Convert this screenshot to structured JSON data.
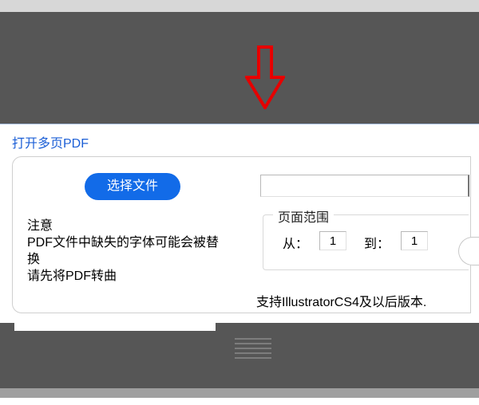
{
  "dialog": {
    "title": "打开多页PDF",
    "select_file_label": "选择文件",
    "file_path_value": "",
    "note_label": "注意",
    "note_line1a": "PDF文件中缺失的字体可能会被替",
    "note_line1b": "换",
    "note_line2": "请先将PDF转曲",
    "page_range": {
      "legend": "页面范围",
      "from_label": "从：",
      "from_value": "1",
      "to_label": "到：",
      "to_value": "1"
    },
    "support_text": "支持IllustratorCS4及以后版本."
  },
  "arrow": {
    "name": "down-arrow-icon",
    "color": "#e60000"
  }
}
